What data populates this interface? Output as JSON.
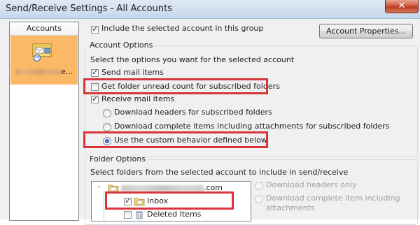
{
  "window": {
    "title": "Send/Receive Settings - All Accounts",
    "close_glyph": "✕"
  },
  "accounts_panel": {
    "header": "Accounts",
    "selected_account": {
      "name_suffix": "e...",
      "icon": "mail-account-icon"
    }
  },
  "include_account": {
    "label": "Include the selected account in this group",
    "checked": true
  },
  "account_properties_button": "Account Properties...",
  "account_options": {
    "title": "Account Options",
    "description": "Select the options you want for the selected account",
    "send_mail": {
      "label": "Send mail items",
      "checked": true
    },
    "unread_count": {
      "label": "Get folder unread count for subscribed folders",
      "checked": false
    },
    "receive_mail": {
      "label": "Receive mail items",
      "checked": true
    },
    "radio_options": [
      {
        "label": "Download headers for subscribed folders",
        "selected": false
      },
      {
        "label": "Download complete items including attachments for subscribed folders",
        "selected": false
      },
      {
        "label": "Use the custom behavior defined below",
        "selected": true
      }
    ]
  },
  "folder_options": {
    "title": "Folder Options",
    "description": "Select folders from the selected account to include in send/receive",
    "tree": {
      "root_suffix": ".com",
      "expander": "–",
      "folders": [
        {
          "name": "Inbox",
          "checked": true
        },
        {
          "name": "Deleted Items",
          "checked": false
        }
      ]
    },
    "download_radios": [
      {
        "label": "Download headers only",
        "enabled": false
      },
      {
        "label": "Download complete item including",
        "label2": "attachments",
        "enabled": false
      }
    ]
  },
  "colors": {
    "highlight_box": "#d9353a",
    "selected_account_bg": "#fbb967",
    "window_bg": "#f0f0f0"
  }
}
